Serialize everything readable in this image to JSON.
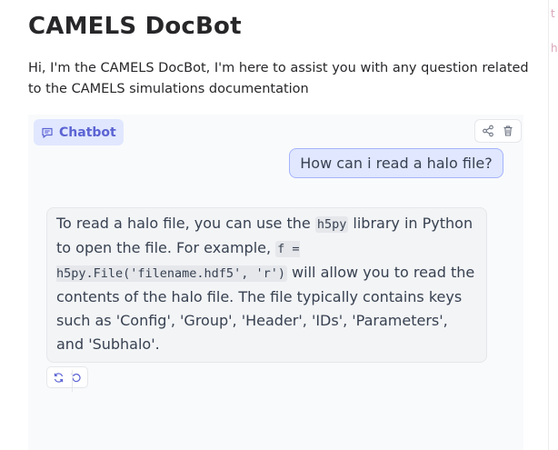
{
  "page": {
    "title": "CAMELS DocBot",
    "description": "Hi, I'm the CAMELS DocBot, I'm here to assist you with any question related to the CAMELS simulations documentation"
  },
  "chatbot": {
    "label": "Chatbot",
    "tools": {
      "share_icon": "share-icon",
      "delete_icon": "trash-icon"
    },
    "messages": {
      "user": "How can i read a halo file?",
      "bot": {
        "t1": "To read a halo file, you can use the ",
        "c1": "h5py",
        "t2": " library in Python to open the file. For example, ",
        "c2": "f = h5py.File('filename.hdf5', 'r')",
        "t3": " will allow you to read the contents of the halo file. The file typically contains keys such as 'Config', 'Group', 'Header', 'IDs', 'Parameters', and 'Subhalo'."
      }
    },
    "message_actions": {
      "retry_icon": "retry-icon",
      "undo_icon": "undo-icon"
    }
  },
  "colors": {
    "accent": "#5b63d3",
    "user_bubble_bg": "#e0e7ff",
    "user_bubble_border": "#a5b4fc",
    "bot_bubble_bg": "#f3f4f6",
    "panel_bg": "#f9fafb"
  }
}
